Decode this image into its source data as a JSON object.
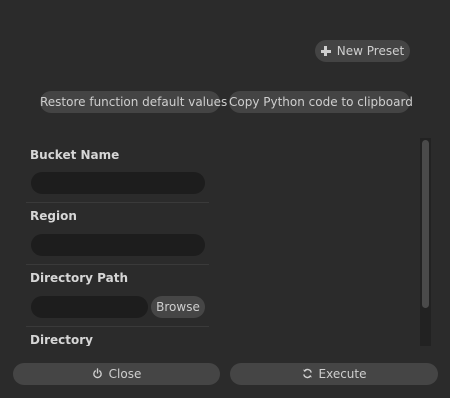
{
  "toolbar": {
    "new_preset_label": "New Preset",
    "restore_defaults_label": "Restore function default values",
    "copy_python_label": "Copy Python code to clipboard"
  },
  "form": {
    "fields": [
      {
        "label": "Bucket Name",
        "value": ""
      },
      {
        "label": "Region",
        "value": ""
      },
      {
        "label": "Directory Path",
        "value": "",
        "browse_label": "Browse"
      },
      {
        "label": "Directory"
      }
    ]
  },
  "footer": {
    "close_label": "Close",
    "execute_label": "Execute"
  },
  "icons": {
    "new_preset": "plus-icon",
    "close": "power-icon",
    "execute": "refresh-icon"
  },
  "colors": {
    "background": "#2b2b2b",
    "button": "#444444",
    "input": "#1d1d1d",
    "text": "#cfcfcf"
  }
}
